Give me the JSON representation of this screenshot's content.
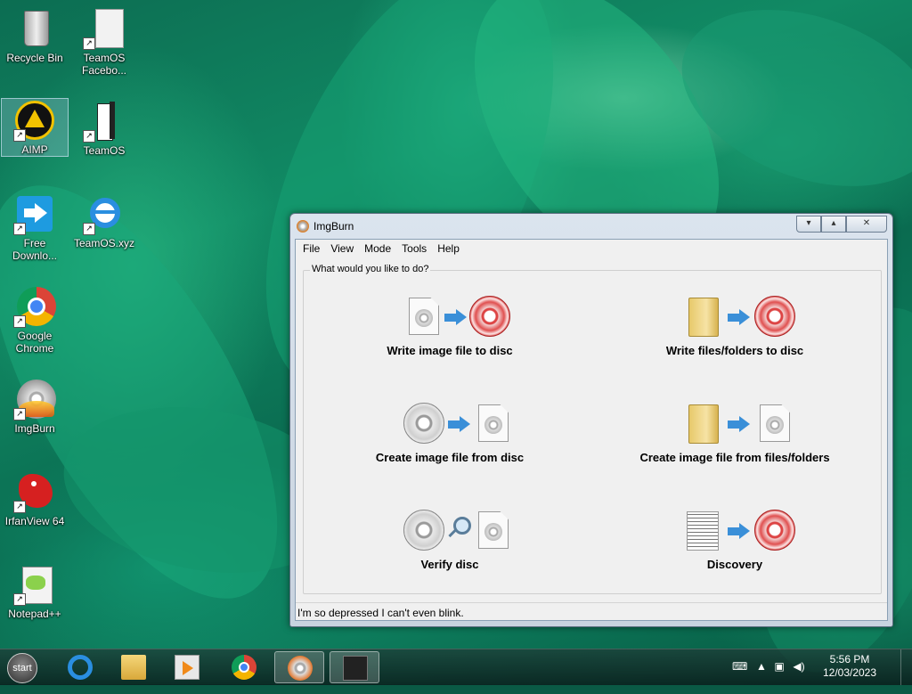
{
  "desktop": {
    "icons": [
      {
        "label": "Recycle Bin",
        "icon": "recycle-bin-icon"
      },
      {
        "label": "TeamOS Facebo...",
        "icon": "document-shortcut-icon"
      },
      {
        "label": "AIMP",
        "icon": "aimp-icon"
      },
      {
        "label": "TeamOS",
        "icon": "folder-doc-icon"
      },
      {
        "label": "Free Downlo...",
        "icon": "download-manager-icon"
      },
      {
        "label": "TeamOS.xyz",
        "icon": "internet-explorer-icon"
      },
      {
        "label": "Google Chrome",
        "icon": "chrome-icon"
      },
      {
        "label": "ImgBurn",
        "icon": "imgburn-icon"
      },
      {
        "label": "IrfanView 64",
        "icon": "irfanview-icon"
      },
      {
        "label": "Notepad++",
        "icon": "notepadpp-icon"
      }
    ]
  },
  "window": {
    "title": "ImgBurn",
    "menu": [
      "File",
      "View",
      "Mode",
      "Tools",
      "Help"
    ],
    "group_label": "What would you like to do?",
    "actions": [
      {
        "label": "Write image file to disc"
      },
      {
        "label": "Write files/folders to disc"
      },
      {
        "label": "Create image file from disc"
      },
      {
        "label": "Create image file from files/folders"
      },
      {
        "label": "Verify disc"
      },
      {
        "label": "Discovery"
      }
    ],
    "status": "I'm so depressed I can't even blink."
  },
  "taskbar": {
    "start_label": "start",
    "pinned": [
      "internet-explorer-icon",
      "file-explorer-icon",
      "media-player-icon",
      "chrome-icon",
      "imgburn-icon",
      "terminal-icon"
    ],
    "clock_time": "5:56 PM",
    "clock_date": "12/03/2023"
  },
  "colors": {
    "accent_blue": "#3a8fd8",
    "disc_red": "#d33333"
  }
}
